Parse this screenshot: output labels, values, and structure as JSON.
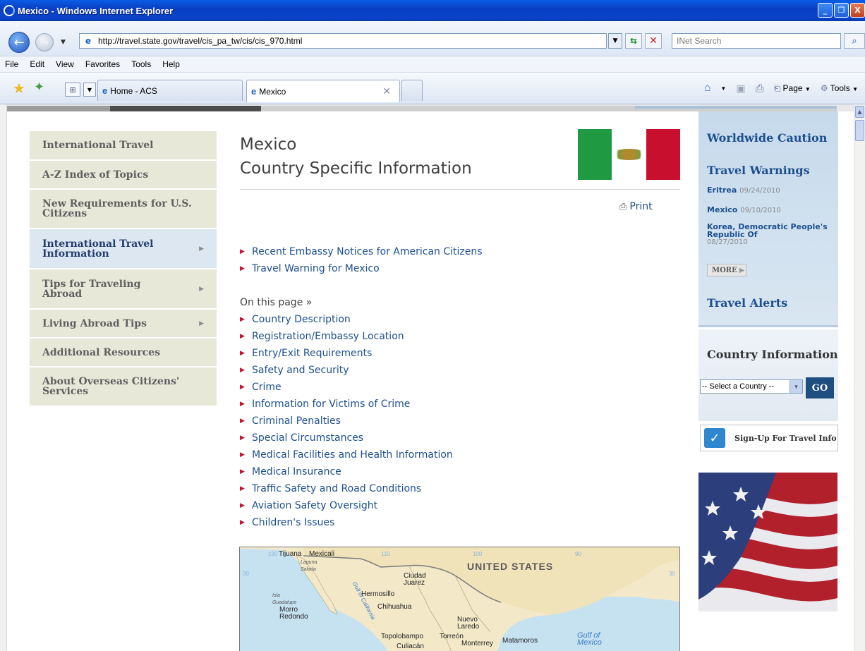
{
  "window": {
    "title": "Mexico - Windows Internet Explorer",
    "controls": [
      "_",
      "❐",
      "X"
    ]
  },
  "address_bar": {
    "url": "http://travel.state.gov/travel/cis_pa_tw/cis/cis_970.html",
    "search_placeholder": "INet Search"
  },
  "menu": [
    "File",
    "Edit",
    "View",
    "Favorites",
    "Tools",
    "Help"
  ],
  "tabs": [
    {
      "label": "Home - ACS",
      "active": false
    },
    {
      "label": "Mexico",
      "active": true
    }
  ],
  "command_bar": {
    "page_label": "Page",
    "tools_label": "Tools"
  },
  "left_nav": [
    {
      "label": "International Travel",
      "has_arrow": false,
      "active": false
    },
    {
      "label": "A-Z Index of Topics",
      "has_arrow": false,
      "active": false
    },
    {
      "label": "New Requirements for U.S. Citizens",
      "has_arrow": false,
      "active": false
    },
    {
      "label": "International Travel Information",
      "has_arrow": true,
      "active": true
    },
    {
      "label": "Tips for Traveling Abroad",
      "has_arrow": true,
      "active": false
    },
    {
      "label": "Living Abroad Tips",
      "has_arrow": true,
      "active": false
    },
    {
      "label": "Additional Resources",
      "has_arrow": false,
      "active": false
    },
    {
      "label": "About Overseas Citizens' Services",
      "has_arrow": false,
      "active": false
    }
  ],
  "main": {
    "title_line1": "Mexico",
    "title_line2": "Country Specific Information",
    "print_label": "Print",
    "top_links": [
      "Recent Embassy Notices for American Citizens",
      "Travel Warning for Mexico"
    ],
    "on_this_page": "On this page »",
    "page_links": [
      "Country Description",
      "Registration/Embassy Location",
      "Entry/Exit Requirements",
      "Safety and Security",
      "Crime",
      "Information for Victims of Crime",
      "Criminal Penalties",
      "Special Circumstances",
      "Medical Facilities and Health Information",
      "Medical Insurance",
      "Traffic Safety and Road Conditions",
      "Aviation Safety Oversight",
      "Children's Issues"
    ]
  },
  "map": {
    "labels": {
      "tijuana": "Tijuana",
      "mexicali": "Mexicali",
      "laguna": "Laguna Salada",
      "us": "UNITED STATES",
      "ciudad": "Ciudad Juarez",
      "hermosillo": "Hermosillo",
      "isla": "Isla Guadalupe",
      "chihuahua": "Chihuahua",
      "morro": "Morro Redondo",
      "gulf_cal": "Gulf of California",
      "nuevo": "Nuevo Laredo",
      "topolobampo": "Topolobampo",
      "torreon": "Torreón",
      "monterrey": "Monterrey",
      "matamoros": "Matamoros",
      "culiacan": "Culiacán",
      "gulf_mex": "Gulf of Mexico",
      "t130": "130",
      "t110": "110",
      "t100": "100",
      "t90": "90",
      "t30a": "30",
      "t30b": "30"
    }
  },
  "sidebar": {
    "worldwide_caution": "Worldwide Caution",
    "travel_warnings": "Travel Warnings",
    "warnings": [
      {
        "country": "Eritrea",
        "date": "09/24/2010"
      },
      {
        "country": "Mexico",
        "date": "09/10/2010"
      },
      {
        "country": "Korea, Democratic People's Republic Of",
        "date": "08/27/2010"
      }
    ],
    "more_label": "MORE",
    "travel_alerts": "Travel Alerts",
    "country_information": "Country Information",
    "select_value": "-- Select a Country --",
    "go_label": "GO",
    "signup_label": "Sign-Up For Travel Info"
  },
  "colors": {
    "link": "#1d4f8f",
    "bullet": "#c8102e",
    "nav_bg": "#e8e8d9",
    "nav_active_bg": "#dce7f1",
    "sidebar_blue": "#c6daec",
    "go_button": "#1f4f80"
  },
  "icons": {
    "back": "back-arrow-icon",
    "forward": "forward-arrow-icon",
    "refresh": "refresh-icon",
    "stop": "stop-icon",
    "search": "search-icon",
    "favorites": "star-icon",
    "home": "home-icon",
    "feeds": "feeds-icon",
    "print": "printer-icon",
    "page": "page-icon",
    "tools": "gear-icon"
  }
}
